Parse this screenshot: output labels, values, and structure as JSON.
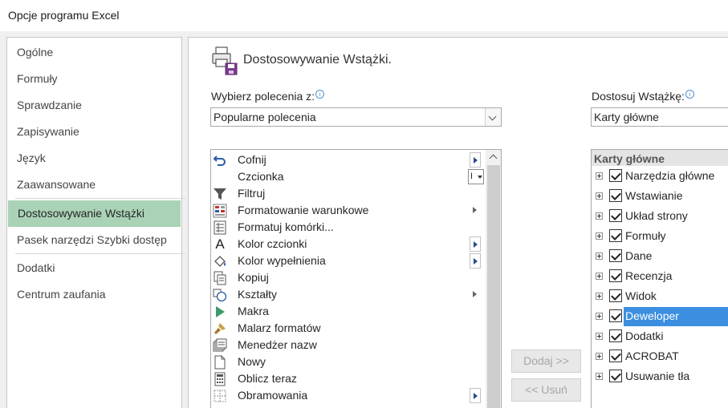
{
  "window": {
    "title": "Opcje programu Excel"
  },
  "sidebar": {
    "items": [
      {
        "label": "Ogólne"
      },
      {
        "label": "Formuły"
      },
      {
        "label": "Sprawdzanie"
      },
      {
        "label": "Zapisywanie"
      },
      {
        "label": "Język"
      },
      {
        "label": "Zaawansowane"
      },
      {
        "label": "Dostosowywanie Wstążki",
        "active": true
      },
      {
        "label": "Pasek narzędzi Szybki dostęp"
      },
      {
        "label": "Dodatki"
      },
      {
        "label": "Centrum zaufania"
      }
    ]
  },
  "main": {
    "title": "Dostosowywanie Wstążki.",
    "choose_label": "Wybierz polecenia z:",
    "choose_value": "Popularne polecenia",
    "customize_label": "Dostosuj Wstążkę:",
    "customize_value": "Karty główne",
    "commands": [
      {
        "label": "Cofnij",
        "icon": "undo-icon"
      },
      {
        "label": "Czcionka",
        "icon": "",
        "extra": "I"
      },
      {
        "label": "Filtruj",
        "icon": "filter-icon"
      },
      {
        "label": "Formatowanie warunkowe",
        "icon": "conditional-format-icon"
      },
      {
        "label": "Formatuj komórki...",
        "icon": "format-cells-icon"
      },
      {
        "label": "Kolor czcionki",
        "icon": "font-color-icon",
        "glyph": "A"
      },
      {
        "label": "Kolor wypełnienia",
        "icon": "fill-color-icon"
      },
      {
        "label": "Kopiuj",
        "icon": "copy-icon"
      },
      {
        "label": "Kształty",
        "icon": "shapes-icon"
      },
      {
        "label": "Makra",
        "icon": "macros-icon"
      },
      {
        "label": "Malarz formatów",
        "icon": "format-painter-icon"
      },
      {
        "label": "Menedżer nazw",
        "icon": "name-manager-icon"
      },
      {
        "label": "Nowy",
        "icon": "new-document-icon"
      },
      {
        "label": "Oblicz teraz",
        "icon": "calculator-icon"
      },
      {
        "label": "Obramowania",
        "icon": "borders-icon"
      }
    ],
    "add_button": "Dodaj >>",
    "remove_button": "<< Usuń",
    "tabs_header": "Karty główne",
    "tabs": [
      {
        "label": "Narzędzia główne"
      },
      {
        "label": "Wstawianie"
      },
      {
        "label": "Układ strony"
      },
      {
        "label": "Formuły"
      },
      {
        "label": "Dane"
      },
      {
        "label": "Recenzja"
      },
      {
        "label": "Widok"
      },
      {
        "label": "Deweloper",
        "selected": true
      },
      {
        "label": "Dodatki"
      },
      {
        "label": "ACROBAT"
      },
      {
        "label": "Usuwanie tła"
      }
    ]
  },
  "colors": {
    "accent": "#a9d2b7",
    "selection": "#3c8fe0"
  }
}
